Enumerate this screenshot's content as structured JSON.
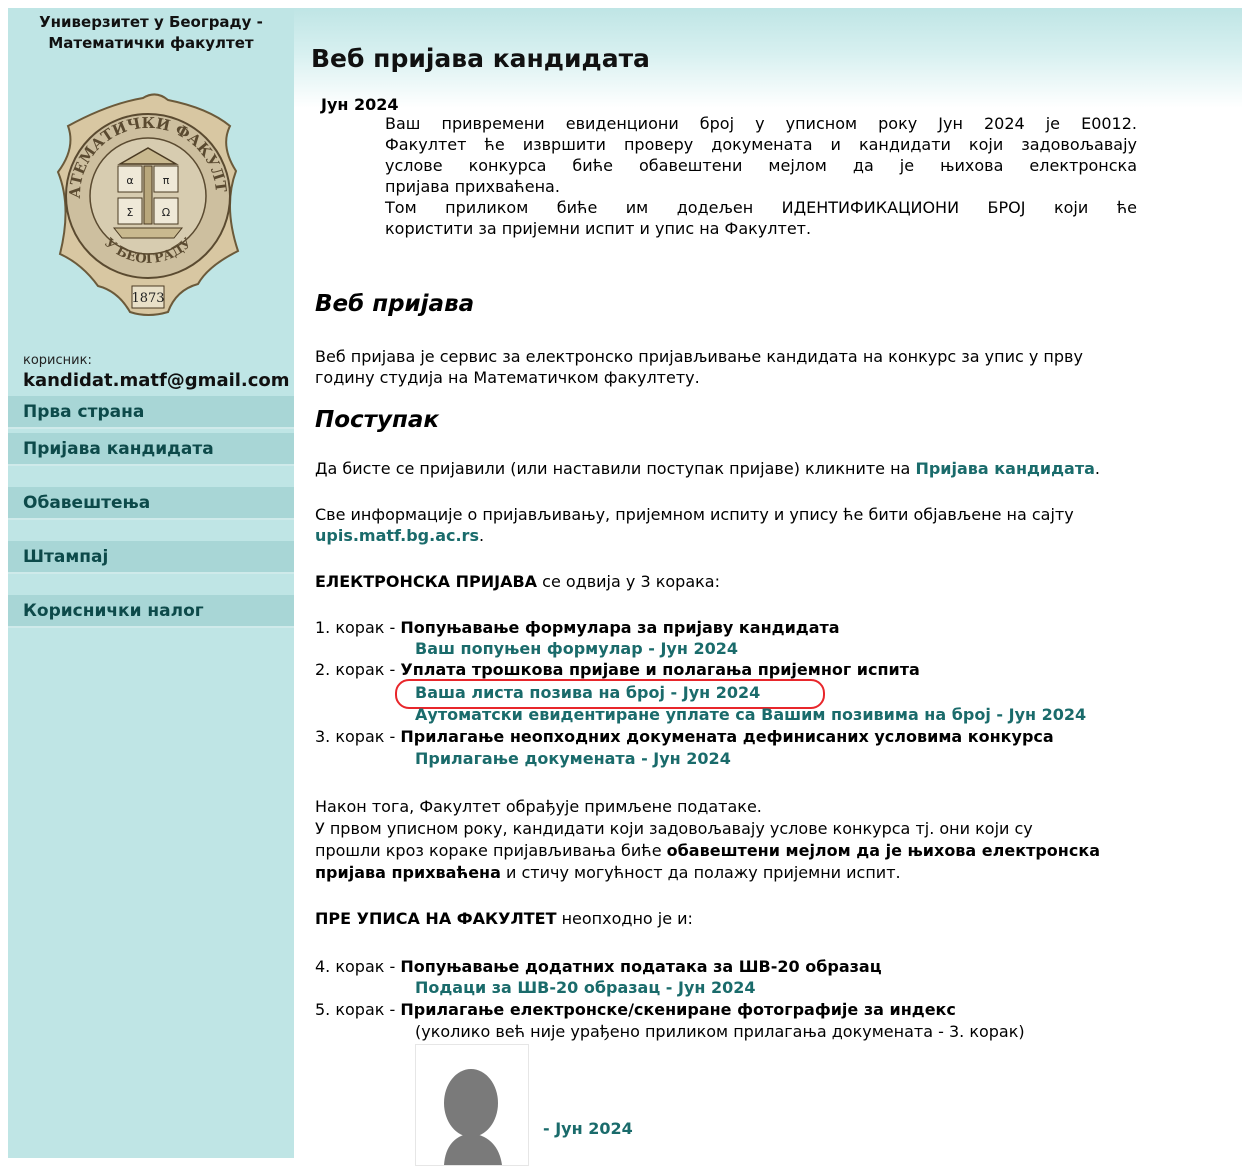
{
  "sidebar": {
    "university_line1": "Универзитет у Београду -",
    "university_line2": "Математички факултет",
    "seal": {
      "arc_text": "МАТЕМАТИЧКИ ФАКУЛТЕТ",
      "bottom_text": "У БЕОГРАДУ",
      "year": "1873",
      "letters": [
        "α",
        "π",
        "Σ",
        "Ω"
      ]
    },
    "user_label": "корисник:",
    "user_email": "kandidat.matf@gmail.com",
    "nav": [
      {
        "label": "Прва страна"
      },
      {
        "label": "Пријава кандидата"
      },
      {
        "label": "Обавештења"
      },
      {
        "label": "Штампај"
      },
      {
        "label": "Кориснички налог"
      }
    ]
  },
  "header": {
    "title": "Веб пријава кандидата"
  },
  "notice": {
    "term": "Јун 2024",
    "lines": [
      "Ваш привремени евиденциони број у уписном року Јун 2024 је Е0012.",
      "Факултет ће извршити проверу докумената и кандидати који задовољавају",
      "услове конкурса биће обавештени мејлом да је њихова електронска",
      "пријава прихваћена.",
      "Том приликом биће им додељен ИДЕНТИФИКАЦИОНИ БРОЈ који ће",
      "користити за пријемни испит и упис на Факултет."
    ]
  },
  "about": {
    "heading": "Веб пријава",
    "line1": "Веб пријава је сервис за електронско пријављивање кандидата на конкурс за упис у прву",
    "line2": "годину студија на Математичком факултету."
  },
  "procedure": {
    "heading": "Поступак",
    "p1_text": "Да бисте се пријавили (или наставили поступак пријаве) кликните на ",
    "p1_link": "Пријава кандидата",
    "p1_end": ".",
    "p2_line1": "Све информације о пријављивању, пријемном испиту и упису ће бити објављене на сајту",
    "p2_link": "upis.matf.bg.ac.rs",
    "p2_end": ".",
    "e_bold": "ЕЛЕКТРОНСКА ПРИЈАВА",
    "e_text": " се одвија у 3 корака:",
    "steps": [
      {
        "prefix": "1. корак - ",
        "title": "Попуњавање формулара за пријаву кандидата",
        "links": [
          "Ваш попуњен формулар - Јун 2024"
        ]
      },
      {
        "prefix": "2. корак - ",
        "title": "Уплата трошкова пријаве и полагања пријемног испита",
        "links": [
          "Ваша листа позива на број - Јун 2024",
          "Аутоматски евидентиране уплате са Вашим позивима на број - Јун 2024"
        ]
      },
      {
        "prefix": "3. корак - ",
        "title": "Прилагање неопходних докумената дефинисаних условима конкурса",
        "links": [
          "Прилагање докумената - Јун 2024"
        ]
      }
    ],
    "after1": "Након тога, Факултет обрађује примљене податаке.",
    "after2": "У првом уписном року, кандидати који задовољавају услове конкурса тј. они који су",
    "after3_text": "прошли кроз кораке пријављивања биће ",
    "after3_bold": "обавештени мејлом да је њихова електронска",
    "after4_bold": "пријава прихваћена",
    "after4_text": " и стичу могућност да полажу пријемни испит.",
    "pre_bold": "ПРЕ УПИСА НА ФАКУЛТЕТ",
    "pre_text": " неопходно је и:",
    "step4": {
      "prefix": "4. корак - ",
      "title": "Попуњавање додатних података за ШВ-20 образац",
      "link": "Подаци за ШВ-20 образац - Јун 2024"
    },
    "step5": {
      "prefix": "5. корак - ",
      "title": "Прилагање електронске/скениране фотографије за индекс",
      "note": "(уколико већ није урађено приликом прилагања докумената - 3. корак)"
    },
    "photo_link": "- Јун 2024"
  },
  "colors": {
    "sidebar_bg": "#bfe5e5",
    "nav_bg": "#a8d6d6",
    "link": "#1a6b6b",
    "highlight_circle": "#e8262b"
  }
}
